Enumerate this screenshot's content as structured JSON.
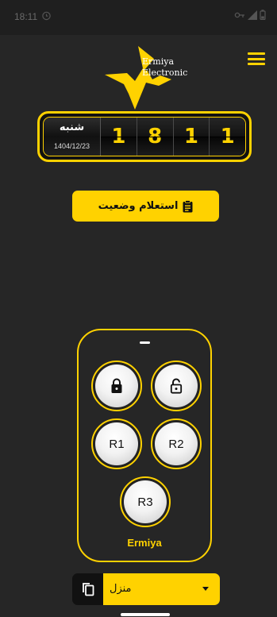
{
  "status_bar": {
    "time": "18:11",
    "alarm_icon": "alarm-clock-icon",
    "indicators": [
      "vpn-key-icon",
      "signal-icon",
      "battery-icon"
    ]
  },
  "brand": {
    "logo_text_line1": "Ermiya",
    "logo_text_line2": "Electronic",
    "accent_color": "#ffd200",
    "background_color": "#262626"
  },
  "menu": {
    "icon": "hamburger-menu-icon"
  },
  "counter": {
    "day_name": "شنبه",
    "date": "1404/12/23",
    "digits": [
      "1",
      "8",
      "1",
      "1"
    ]
  },
  "inquiry_button": {
    "label": "استعلام وضعیت",
    "icon": "clipboard-icon"
  },
  "remote": {
    "buttons": {
      "lock": {
        "icon": "lock-closed-icon"
      },
      "unlock": {
        "icon": "lock-open-icon"
      },
      "r1": "R1",
      "r2": "R2",
      "r3": "R3"
    },
    "brand": "Ermiya"
  },
  "location_selector": {
    "selected": "منزل",
    "icon": "copy-icon"
  }
}
